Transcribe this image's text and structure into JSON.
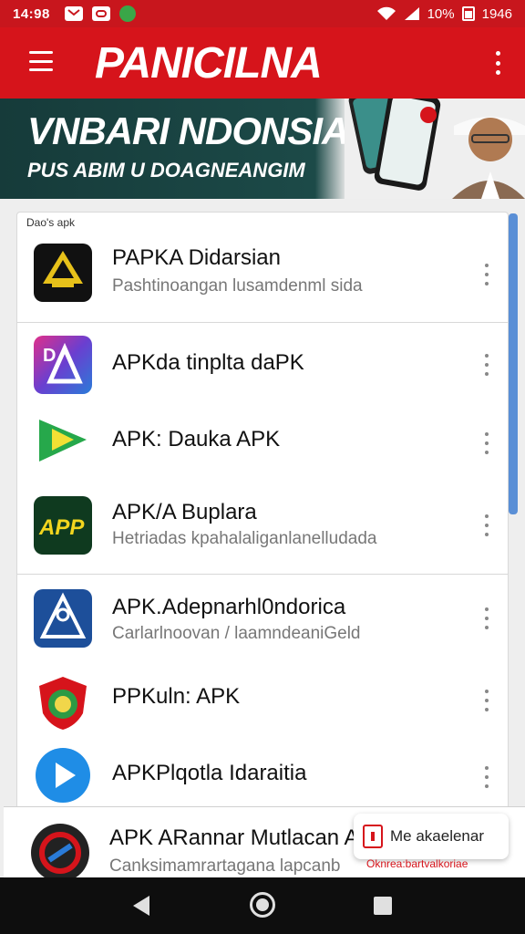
{
  "status_bar": {
    "time": "14:98",
    "battery": "10%",
    "clock_right": "1946",
    "icons": [
      "mail-icon",
      "youtube-icon",
      "app-icon",
      "wifi-icon",
      "signal-icon",
      "battery-icon"
    ]
  },
  "app_bar": {
    "title": "PANICILNA",
    "menu_icon": "menu-icon",
    "more_icon": "more-vert-icon"
  },
  "banner": {
    "headline": "VNBARI NDONSIA",
    "subheadline": "PUS ABIM U DOAGNEANGIM"
  },
  "list": {
    "caption": "Dao's apk",
    "items": [
      {
        "title": "PAPKA Didarsian",
        "subtitle": "Pashtinoangan lusamdenml sida",
        "icon": "golden-emblem-icon"
      },
      {
        "title": "APKda tinplta daPK",
        "subtitle": "",
        "icon": "da-logo-icon"
      },
      {
        "title": "APK: Dauka APK",
        "subtitle": "",
        "icon": "green-play-icon"
      },
      {
        "title": "APK/A Buplara",
        "subtitle": "Hetriadas kpahalaliganlanelludada",
        "icon": "app-text-icon"
      },
      {
        "title": "APK.Adepnarhl0ndorica",
        "subtitle": "Carlarlnoovan / laamndeaniGeld",
        "icon": "blue-emblem-icon"
      },
      {
        "title": "PPKuln: APK",
        "subtitle": "",
        "icon": "shield-garuda-icon"
      },
      {
        "title": "APKPlqotla Idaraitia",
        "subtitle": "",
        "icon": "blue-play-icon"
      },
      {
        "title": "APK ARannar Mutlacan A",
        "subtitle": "Canksimamrartagana lapcanb",
        "icon": "circle-logo-icon"
      }
    ]
  },
  "toast": {
    "text": "Me akaelenar",
    "sub": "Oknrea:bartvalkoriae"
  },
  "nav_bar": {
    "back": "back-icon",
    "home": "home-icon",
    "recent": "recent-apps-icon"
  },
  "colors": {
    "primary_red": "#d6141b",
    "banner_dark": "#163b3a",
    "scroll_blue": "#5a8fd6"
  }
}
